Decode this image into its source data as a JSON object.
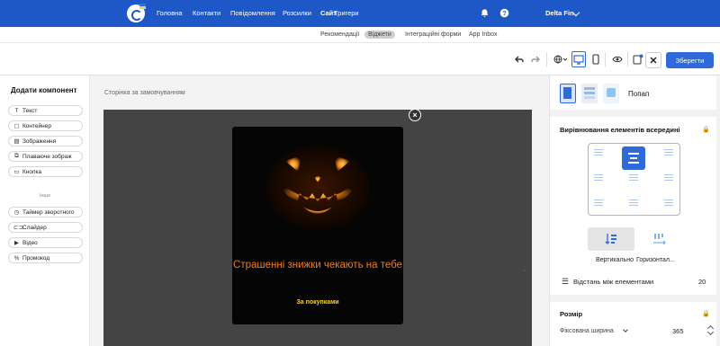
{
  "nav": {
    "items": [
      "Головна",
      "Контакти",
      "Повідомлення",
      "Розсилки",
      "Сайт",
      "Тригери"
    ],
    "active_index": 4,
    "account": "Delta Fin"
  },
  "subtabs": {
    "items": [
      "Рекомендації",
      "Віджети",
      "Інтеграційні форми",
      "App Inbox"
    ],
    "active_index": 1
  },
  "toolbar": {
    "save_label": "Зберегти",
    "close_label": "✕"
  },
  "left_panel": {
    "title": "Додати компонент",
    "components": [
      "Текст",
      "Контейнер",
      "Зображення",
      "Плаваюче зображ",
      "Кнопка"
    ],
    "other_label": "Інше",
    "other_components": [
      "Таймер зворотного",
      "Слайдер",
      "Відео",
      "Промокод"
    ]
  },
  "canvas": {
    "page_label": "Сторінка за замовчуванням",
    "popup_title": "Страшенні знижки чекають на тебе",
    "popup_button": "За покупками"
  },
  "right_panel": {
    "type_label": "Попап",
    "alignment_title": "Вирівнювання елементів всередині",
    "direction_vertical": "Вертикально",
    "direction_horizontal": "Горизонтал...",
    "spacing_label": "Відстань між елементами",
    "spacing_value": "20",
    "size_title": "Розмір",
    "width_mode": "Фіксована ширина",
    "width_value": "365"
  },
  "colors": {
    "brand": "#1e57c6",
    "accent": "#2e6bd8",
    "popup_title": "#f07b1a",
    "popup_button": "#f2d23c"
  }
}
